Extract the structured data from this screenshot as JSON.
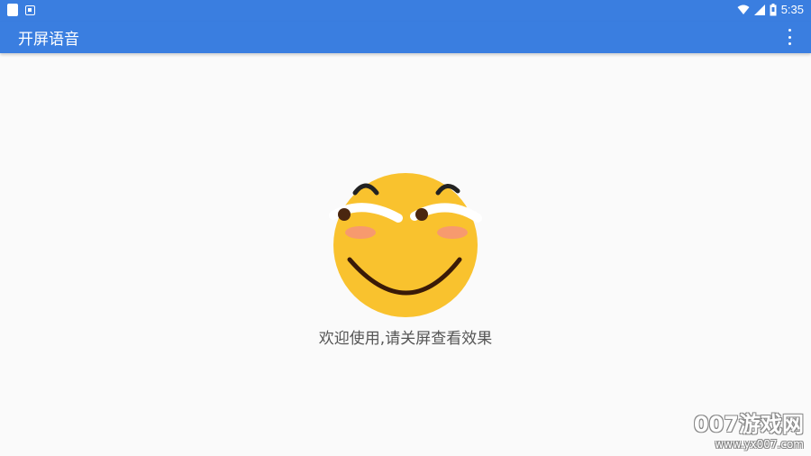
{
  "status_bar": {
    "time": "5:35",
    "icons": [
      "notification-icon",
      "app-notification-icon",
      "wifi-icon",
      "signal-icon",
      "battery-icon"
    ]
  },
  "app_bar": {
    "title": "开屏语音",
    "overflow_icon": "more-vert-icon"
  },
  "main": {
    "emoji_icon": "smiley-face-icon",
    "welcome_text": "欢迎使用,请关屏查看效果"
  },
  "watermark": {
    "logo": "007游戏网",
    "url": "www.yx007.com"
  },
  "colors": {
    "primary": "#3a7ee0",
    "background": "#fafafa",
    "face": "#f9c22e",
    "cheek": "#f79a6e",
    "text": "#555555"
  }
}
